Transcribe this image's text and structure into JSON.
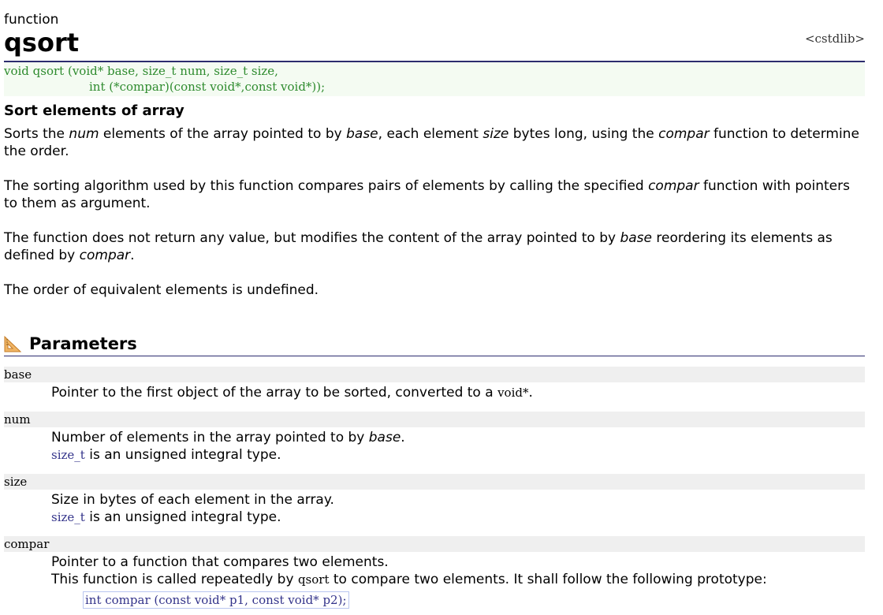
{
  "header": {
    "kind": "function",
    "name": "qsort",
    "library": "<cstdlib>"
  },
  "prototype": {
    "line1": "void qsort (void* base, size_t num, size_t size,",
    "line2": "int (*compar)(const void*,const void*));"
  },
  "summary": "Sort elements of array",
  "description": {
    "p1": [
      "Sorts the ",
      "num",
      " elements of the array pointed to by ",
      "base",
      ", each element ",
      "size",
      " bytes long, using the ",
      "compar",
      " function to determine the order."
    ],
    "p2": [
      "The sorting algorithm used by this function compares pairs of elements by calling the specified ",
      "compar",
      " function with pointers to them as argument."
    ],
    "p3": [
      "The function does not return any value, but modifies the content of the array pointed to by ",
      "base",
      " reordering its elements as defined by ",
      "compar",
      "."
    ],
    "p4": "The order of equivalent elements is undefined."
  },
  "parameters": {
    "heading": "Parameters",
    "icon": "set-square-icon",
    "items": [
      {
        "name": "base",
        "desc": [
          "Pointer to the first object of the array to be sorted, converted to a ",
          "void*",
          "."
        ]
      },
      {
        "name": "num",
        "desc": [
          "Number of elements in the array pointed to by ",
          "base",
          "."
        ],
        "desc2": [
          "size_t",
          " is an unsigned integral type."
        ]
      },
      {
        "name": "size",
        "desc": "Size in bytes of each element in the array.",
        "desc2": [
          "size_t",
          " is an unsigned integral type."
        ]
      },
      {
        "name": "compar",
        "desc": "Pointer to a function that compares two elements.",
        "desc2": [
          "This function is called repeatedly by ",
          "qsort",
          " to compare two elements. It shall follow the following prototype:"
        ],
        "code": "int compar (const void* p1, const void* p2);"
      }
    ]
  }
}
